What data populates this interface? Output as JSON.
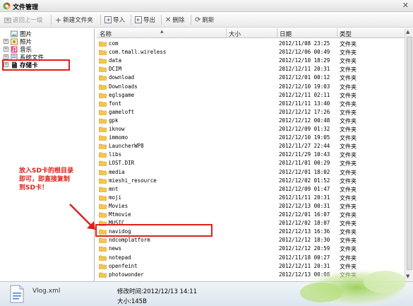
{
  "window": {
    "title": "文件管理",
    "close_glyph": "✕"
  },
  "toolbar": {
    "back": "返回上一级",
    "new_folder": "新建文件夹",
    "import": "导入",
    "export": "导出",
    "delete": "删除",
    "refresh": "刷新"
  },
  "tree": {
    "items": [
      {
        "label": "图片",
        "icon": "image-icon"
      },
      {
        "label": "照片",
        "icon": "photo-icon"
      },
      {
        "label": "音乐",
        "icon": "music-icon"
      },
      {
        "label": "系统文件",
        "icon": "system-file-icon"
      },
      {
        "label": "存储卡",
        "icon": "sd-card-icon"
      }
    ]
  },
  "list": {
    "headers": {
      "name": "名称",
      "size": "大小",
      "date": "日期",
      "type": "类型"
    },
    "rows": [
      {
        "name": "com",
        "date": "2012/11/08 23:25",
        "type": "文件夹"
      },
      {
        "name": "com.tmall.wireless",
        "date": "2012/12/06 00:49",
        "type": "文件夹"
      },
      {
        "name": "data",
        "date": "2012/12/10 18:29",
        "type": "文件夹"
      },
      {
        "name": "DCIM",
        "date": "2012/12/11 20:31",
        "type": "文件夹"
      },
      {
        "name": "download",
        "date": "2012/12/01 00:12",
        "type": "文件夹"
      },
      {
        "name": "Downloads",
        "date": "2012/12/10 19:03",
        "type": "文件夹"
      },
      {
        "name": "eglsgame",
        "date": "2012/12/11 02:11",
        "type": "文件夹"
      },
      {
        "name": "font",
        "date": "2012/11/11 13:40",
        "type": "文件夹"
      },
      {
        "name": "gameloft",
        "date": "2012/12/12 17:26",
        "type": "文件夹"
      },
      {
        "name": "gpk",
        "date": "2012/12/12 00:48",
        "type": "文件夹"
      },
      {
        "name": "iknow",
        "date": "2012/12/09 01:32",
        "type": "文件夹"
      },
      {
        "name": "immomo",
        "date": "2012/12/10 19:05",
        "type": "文件夹"
      },
      {
        "name": "LauncherWP8",
        "date": "2012/11/27 22:44",
        "type": "文件夹"
      },
      {
        "name": "libs",
        "date": "2012/11/29 10:43",
        "type": "文件夹"
      },
      {
        "name": "LOST.DIR",
        "date": "2012/11/01 00:29",
        "type": "文件夹"
      },
      {
        "name": "media",
        "date": "2012/12/01 18:02",
        "type": "文件夹"
      },
      {
        "name": "mieshi_resource",
        "date": "2012/12/02 01:52",
        "type": "文件夹"
      },
      {
        "name": "mnt",
        "date": "2012/12/09 01:47",
        "type": "文件夹"
      },
      {
        "name": "moji",
        "date": "2012/11/11 20:31",
        "type": "文件夹"
      },
      {
        "name": "Movies",
        "date": "2012/12/13 00:31",
        "type": "文件夹"
      },
      {
        "name": "Mtmovie",
        "date": "2012/12/01 16:07",
        "type": "文件夹"
      },
      {
        "name": "MUSIC",
        "date": "2012/12/02 18:07",
        "type": "文件夹"
      },
      {
        "name": "navidog",
        "date": "2012/12/13 16:36",
        "type": "文件夹"
      },
      {
        "name": "ndcomplatform",
        "date": "2012/12/12 18:30",
        "type": "文件夹"
      },
      {
        "name": "news",
        "date": "2012/12/12 20:59",
        "type": "文件夹"
      },
      {
        "name": "notepad",
        "date": "2012/11/18 00:27",
        "type": "文件夹"
      },
      {
        "name": "openfeint",
        "date": "2012/12/11 20:31",
        "type": "文件夹"
      },
      {
        "name": "photowonder",
        "date": "2012/12/13 00:08",
        "type": "文件夹"
      }
    ]
  },
  "status": {
    "file_name": "Vlog.xml",
    "modified": "修改时间:2012/12/13 14:11",
    "size": "大小:145B"
  },
  "annotation": {
    "text": "放入SD卡的根目录即可，即直接复制到SD卡！",
    "color": "#e0201b"
  },
  "colors": {
    "folder": "#f2c84b",
    "highlight": "#e0201b"
  }
}
